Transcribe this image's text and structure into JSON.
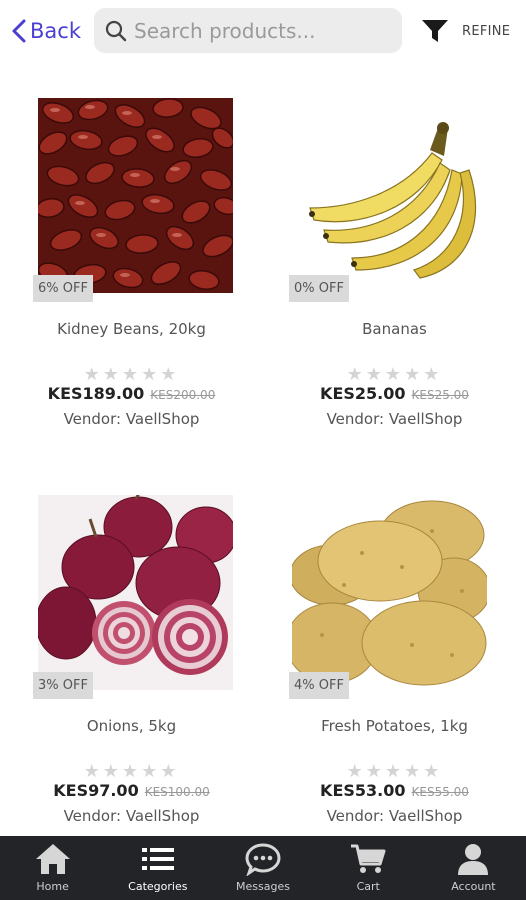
{
  "header": {
    "back_label": "Back",
    "search_placeholder": "Search products...",
    "refine_label": "REFINE",
    "accent_color": "#4a3fd0"
  },
  "products": [
    {
      "name": "Kidney Beans, 20kg",
      "discount": "6% OFF",
      "price": "KES189.00",
      "old_price": "KES200.00",
      "vendor": "Vendor: VaellShop",
      "rating": 0,
      "image": "kidney-beans-image"
    },
    {
      "name": "Bananas",
      "discount": "0% OFF",
      "price": "KES25.00",
      "old_price": "KES25.00",
      "vendor": "Vendor: VaellShop",
      "rating": 0,
      "image": "bananas-image"
    },
    {
      "name": "Onions, 5kg",
      "discount": "3% OFF",
      "price": "KES97.00",
      "old_price": "KES100.00",
      "vendor": "Vendor: VaellShop",
      "rating": 0,
      "image": "onions-image"
    },
    {
      "name": "Fresh Potatoes, 1kg",
      "discount": "4% OFF",
      "price": "KES53.00",
      "old_price": "KES55.00",
      "vendor": "Vendor: VaellShop",
      "rating": 0,
      "image": "potatoes-image"
    }
  ],
  "tabs": [
    {
      "label": "Home",
      "icon": "home-icon",
      "active": false
    },
    {
      "label": "Categories",
      "icon": "list-icon",
      "active": true
    },
    {
      "label": "Messages",
      "icon": "chat-icon",
      "active": false
    },
    {
      "label": "Cart",
      "icon": "cart-icon",
      "active": false
    },
    {
      "label": "Account",
      "icon": "user-icon",
      "active": false
    }
  ]
}
